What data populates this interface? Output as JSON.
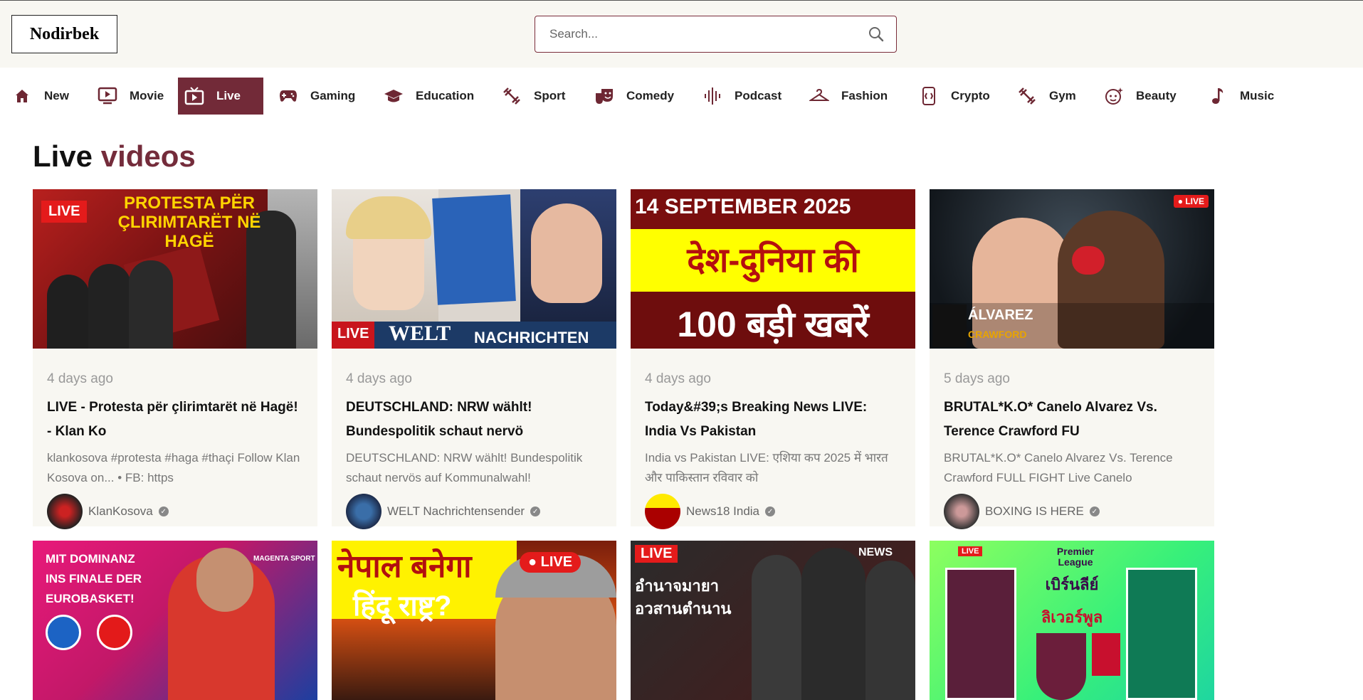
{
  "header": {
    "logo": "Nodirbek",
    "search_placeholder": "Search..."
  },
  "nav": [
    {
      "label": "New",
      "icon": "home-icon"
    },
    {
      "label": "Movie",
      "icon": "monitor-play-icon"
    },
    {
      "label": "Live",
      "icon": "tv-icon",
      "active": true
    },
    {
      "label": "Gaming",
      "icon": "gamepad-icon"
    },
    {
      "label": "Education",
      "icon": "graduation-cap-icon"
    },
    {
      "label": "Sport",
      "icon": "dumbbell-icon"
    },
    {
      "label": "Comedy",
      "icon": "theater-masks-icon"
    },
    {
      "label": "Podcast",
      "icon": "audio-wave-icon"
    },
    {
      "label": "Fashion",
      "icon": "hanger-icon"
    },
    {
      "label": "Crypto",
      "icon": "crypto-chip-icon"
    },
    {
      "label": "Gym",
      "icon": "dumbbell-icon"
    },
    {
      "label": "Beauty",
      "icon": "face-sparkle-icon"
    },
    {
      "label": "Music",
      "icon": "music-note-icon"
    }
  ],
  "section": {
    "title_part1": "Live",
    "title_part2": "videos"
  },
  "cards": [
    {
      "date": "4 days ago",
      "title": "LIVE - Protesta për çlirimtarët në Hagë! - Klan Ko",
      "desc": "klankosova #protesta #haga #thaçi Follow Klan Kosova on... • FB: https",
      "channel": "KlanKosova",
      "thumb_text": "PROTESTA PËR ÇLIRIMTARËT NË HAGË",
      "badge": "LIVE"
    },
    {
      "date": "4 days ago",
      "title": "DEUTSCHLAND: NRW wählt! Bundespolitik schaut nervö",
      "desc": "DEUTSCHLAND: NRW wählt! Bundespolitik schaut nervös auf Kommunalwahl!",
      "channel": "WELT Nachrichtensender",
      "thumb_text": "WELT",
      "thumb_text2": "NACHRICHTEN",
      "badge": "LIVE"
    },
    {
      "date": "4 days ago",
      "title": "Today&#39;s Breaking News LIVE: India Vs Pakistan",
      "desc": "India vs Pakistan LIVE: एशिया कप 2025 में भारत और पाकिस्तान रविवार को",
      "channel": "News18 India",
      "thumb_text": "14 SEPTEMBER 2025",
      "thumb_text2": "देश-दुनिया की",
      "thumb_text3": "100 बड़ी खबरें"
    },
    {
      "date": "5 days ago",
      "title": "BRUTAL*K.O* Canelo Alvarez Vs. Terence Crawford FU",
      "desc": "BRUTAL*K.O* Canelo Alvarez Vs. Terence Crawford FULL FIGHT Live Canelo",
      "channel": "BOXING IS HERE",
      "badge": "● LIVE",
      "thumb_text": "ÁLVAREZ",
      "thumb_text2": "CRAWFORD"
    },
    {
      "thumb_text": "MIT DOMINANZ INS FINALE DER EUROBASKET!",
      "thumb_text2": "MAGENTA SPORT"
    },
    {
      "thumb_text": "नेपाल बनेगा",
      "thumb_text2": "हिंदू राष्ट्र?",
      "badge": "● LIVE"
    },
    {
      "badge": "LIVE",
      "thumb_text": "อำนาจมายา อวสานตำนาน",
      "thumb_text2": "NEWS"
    },
    {
      "badge": "LIVE",
      "thumb_text": "Premier League",
      "thumb_text2": "เบิร์นลีย์",
      "thumb_text3": "ลิเวอร์พูล"
    }
  ],
  "colors": {
    "accent": "#742c3b",
    "header_bg": "#f8f7f2",
    "card_bg": "#f8f7f2"
  }
}
